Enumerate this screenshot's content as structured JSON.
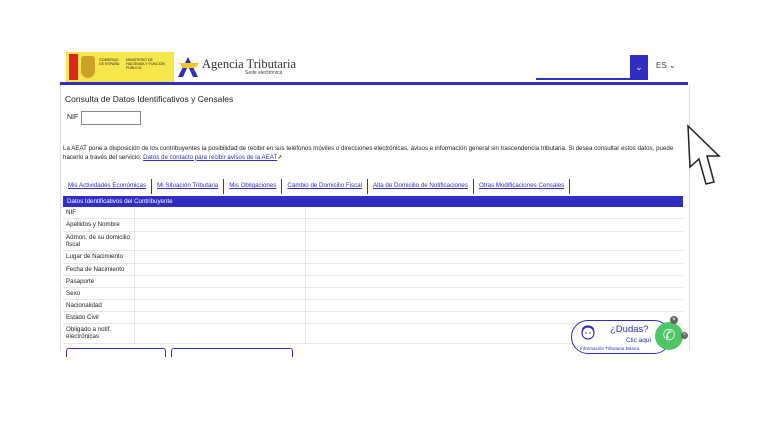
{
  "header": {
    "gov_line1": "GOBIERNO DE ESPAÑA",
    "gov_line2": "MINISTERIO DE HACIENDA Y FUNCIÓN PÚBLICA",
    "agency_name": "Agencia Tributaria",
    "agency_sub": "Sede electrónica",
    "search_value": "",
    "language": "ES",
    "accent": "#2f2dc2"
  },
  "page": {
    "title": "Consulta de Datos Identificativos y Censales",
    "nif_label": "NIF",
    "nif_value": "",
    "info_text": "La AEAT pone a disposición de los contribuyentes la posibilidad de recibir en sus teléfonos móviles o direcciones electrónicas, avisos e información general sin trascendencia tributaria. Si desea consultar estos datos, puede hacerlo a través del servicio: ",
    "info_link": "Datos de contacto para recibir avisos de la AEAT"
  },
  "tabs": [
    "Mis Actividades Económicas",
    "Mi Situación Tributaria",
    "Mis Obligaciones",
    "Cambio de Domicilio Fiscal",
    "Alta de Domicilio de Notificaciones",
    "Otras Modificaciones Censales"
  ],
  "table": {
    "header": "Datos Identificativos del Contribuyente",
    "rows": [
      "NIF",
      "Apellidos y Nombre",
      "Admon. de su domicilio fiscal",
      "Lugar de Nacimiento",
      "Fecha de Nacimiento",
      "Pasaporte",
      "Sexo",
      "Nacionalidad",
      "Estado Civil",
      "Obligado a notif. electrónicas"
    ]
  },
  "help": {
    "title": "¿Dudas?",
    "subtitle": "Clic aquí",
    "bottom": "Información Tributaria Básica"
  }
}
